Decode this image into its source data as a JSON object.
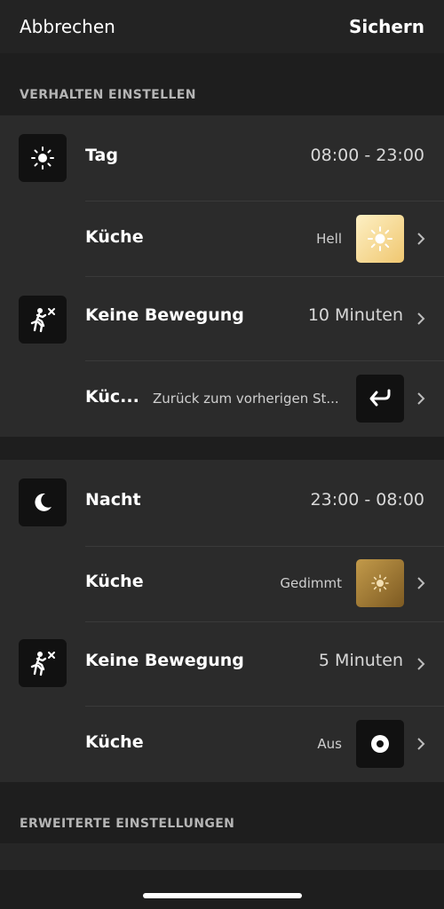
{
  "nav": {
    "cancel_label": "Abbrechen",
    "save_label": "Sichern"
  },
  "section_behavior": {
    "header": "VERHALTEN EINSTELLEN"
  },
  "day": {
    "title": "Tag",
    "time": "08:00 - 23:00",
    "room_label": "Küche",
    "scene_label": "Hell",
    "motion_title": "Keine Bewegung",
    "motion_value": "10 Minuten",
    "after_room_label": "Küc...",
    "after_action": "Zurück zum vorherigen St..."
  },
  "night": {
    "title": "Nacht",
    "time": "23:00 - 08:00",
    "room_label": "Küche",
    "scene_label": "Gedimmt",
    "motion_title": "Keine Bewegung",
    "motion_value": "5 Minuten",
    "after_room_label": "Küche",
    "after_action": "Aus"
  },
  "section_advanced": {
    "header": "ERWEITERTE EINSTELLUNGEN"
  },
  "colors": {
    "background": "#1e1e1e",
    "card": "#2b2b2b",
    "bright_scene": "#f5d98a",
    "dimmed_scene": "#a8782a"
  },
  "icons": {
    "day": "sun-icon",
    "night": "moon-icon",
    "motion": "motion-off-icon",
    "bright": "sun-bright-icon",
    "dimmed": "sun-dim-icon",
    "restore": "return-arrow-icon",
    "off": "power-off-icon",
    "chevron": "chevron-right-icon"
  }
}
